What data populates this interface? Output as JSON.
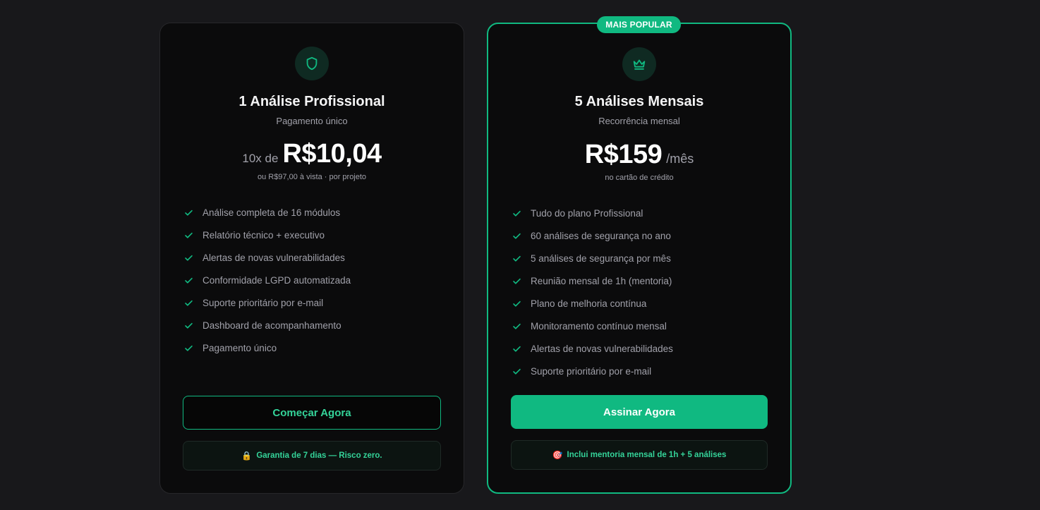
{
  "plans": [
    {
      "icon": "shield-icon",
      "title": "1 Análise Profissional",
      "subtitle": "Pagamento único",
      "price_prefix": "10x de",
      "price": "R$10,04",
      "price_suffix": "",
      "price_note": "ou R$97,00 à vista · por projeto",
      "features": [
        "Análise completa de 16 módulos",
        "Relatório técnico + executivo",
        "Alertas de novas vulnerabilidades",
        "Conformidade LGPD automatizada",
        "Suporte prioritário por e-mail",
        "Dashboard de acompanhamento",
        "Pagamento único"
      ],
      "cta": "Começar Agora",
      "note_emoji": "🔒",
      "note": "Garantia de 7 dias — Risco zero."
    },
    {
      "badge": "MAIS POPULAR",
      "icon": "crown-icon",
      "title": "5 Análises Mensais",
      "subtitle": "Recorrência mensal",
      "price_prefix": "",
      "price": "R$159",
      "price_suffix": "/mês",
      "price_note": "no cartão de crédito",
      "features": [
        "Tudo do plano Profissional",
        "60 análises de segurança no ano",
        "5 análises de segurança por mês",
        "Reunião mensal de 1h (mentoria)",
        "Plano de melhoria contínua",
        "Monitoramento contínuo mensal",
        "Alertas de novas vulnerabilidades",
        "Suporte prioritário por e-mail"
      ],
      "cta": "Assinar Agora",
      "note_emoji": "🎯",
      "note": "Inclui mentoria mensal de 1h + 5 análises"
    }
  ],
  "colors": {
    "accent": "#10b981",
    "accent_text": "#34d399",
    "background": "#18181b",
    "card": "#0b0b0c"
  }
}
